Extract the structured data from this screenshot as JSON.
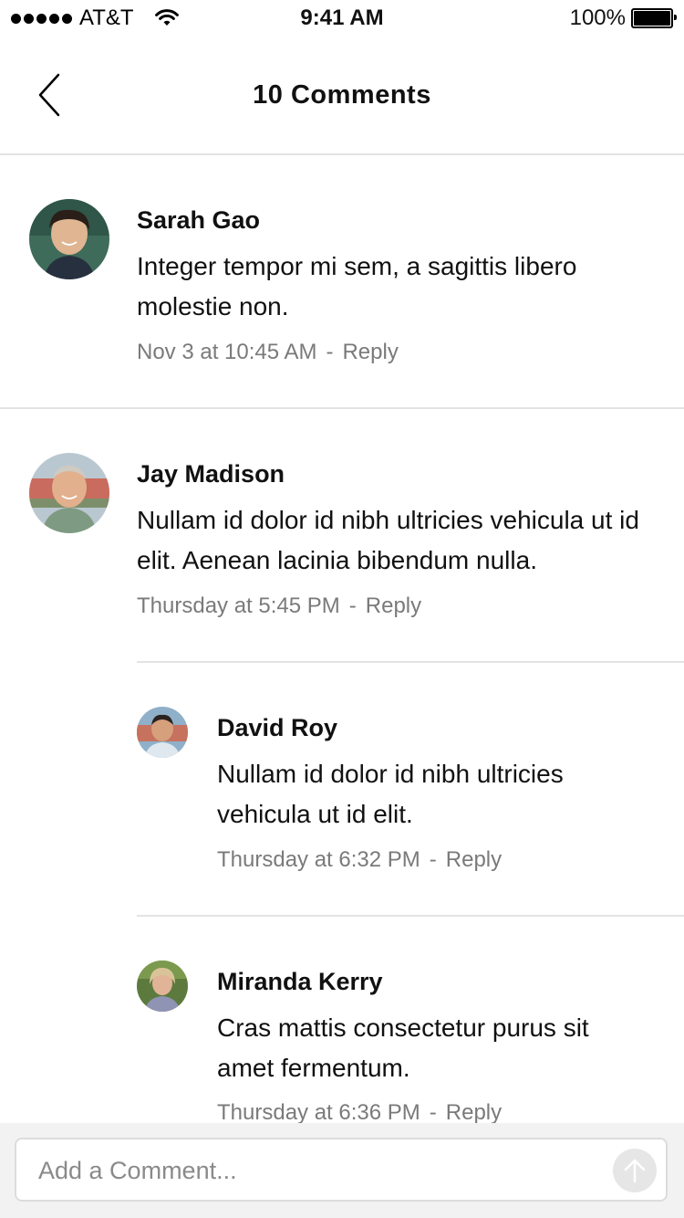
{
  "status_bar": {
    "carrier": "AT&T",
    "time": "9:41 AM",
    "battery": "100%",
    "battery_level": 1.0,
    "icons": [
      "signal-dots-icon",
      "wifi-icon",
      "battery-icon"
    ]
  },
  "nav": {
    "title": "10 Comments",
    "back_icon": "chevron-left-icon"
  },
  "comments": [
    {
      "author": "Sarah Gao",
      "body": "Integer tempor mi sem, a sagittis libero molestie non.",
      "timestamp": "Nov 3 at 10:45 AM",
      "separator": "-",
      "reply": "Reply"
    },
    {
      "author": "Jay Madison",
      "body": "Nullam id dolor id nibh ultricies vehicula ut id elit. Aenean lacinia bibendum nulla.",
      "timestamp": "Thursday at 5:45 PM",
      "separator": "-",
      "reply": "Reply"
    },
    {
      "author": "David Roy",
      "body": "Nullam id dolor id nibh ultricies vehicula ut id elit.",
      "timestamp": "Thursday at 6:32 PM",
      "separator": "-",
      "reply": "Reply"
    },
    {
      "author": "Miranda Kerry",
      "body": "Cras mattis consectetur purus sit amet fermentum.",
      "timestamp": "Thursday at 6:36 PM",
      "separator": "-",
      "reply": "Reply"
    }
  ],
  "composer": {
    "placeholder": "Add a Comment...",
    "send_icon": "arrow-up-icon"
  },
  "colors": {
    "divider": "#e3e3e3",
    "meta_text": "#7a7a7a",
    "composer_bg": "#f2f2f2"
  }
}
